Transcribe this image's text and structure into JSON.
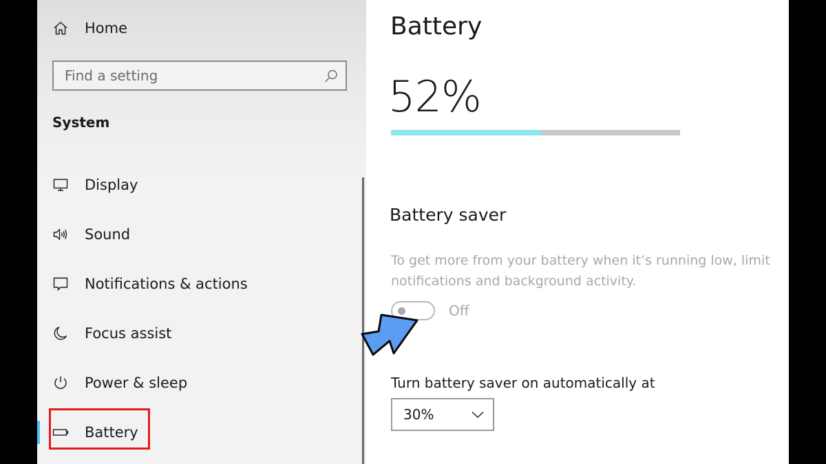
{
  "sidebar": {
    "home_label": "Home",
    "search_placeholder": "Find a setting",
    "section_heading": "System",
    "items": [
      {
        "label": "Display",
        "icon": "display-icon"
      },
      {
        "label": "Sound",
        "icon": "speaker-icon"
      },
      {
        "label": "Notifications & actions",
        "icon": "notification-icon"
      },
      {
        "label": "Focus assist",
        "icon": "moon-icon"
      },
      {
        "label": "Power & sleep",
        "icon": "power-icon"
      },
      {
        "label": "Battery",
        "icon": "battery-icon",
        "selected": true
      }
    ]
  },
  "main": {
    "title": "Battery",
    "battery_percent_text": "52%",
    "battery_level": 0.52,
    "battery_saver": {
      "heading": "Battery saver",
      "description_line1": "To get more from your battery when it’s running low, limit",
      "description_line2": "notifications and background activity.",
      "toggle_state": "Off",
      "toggle_on": false
    },
    "auto_on": {
      "label": "Turn battery saver on automatically at",
      "selected_value": "30%"
    }
  },
  "colors": {
    "accent": "#4cc2ff",
    "battery_fill": "#8ee6ef",
    "highlight_border": "#e31b1b",
    "pointer_arrow": "#5b9df0"
  }
}
